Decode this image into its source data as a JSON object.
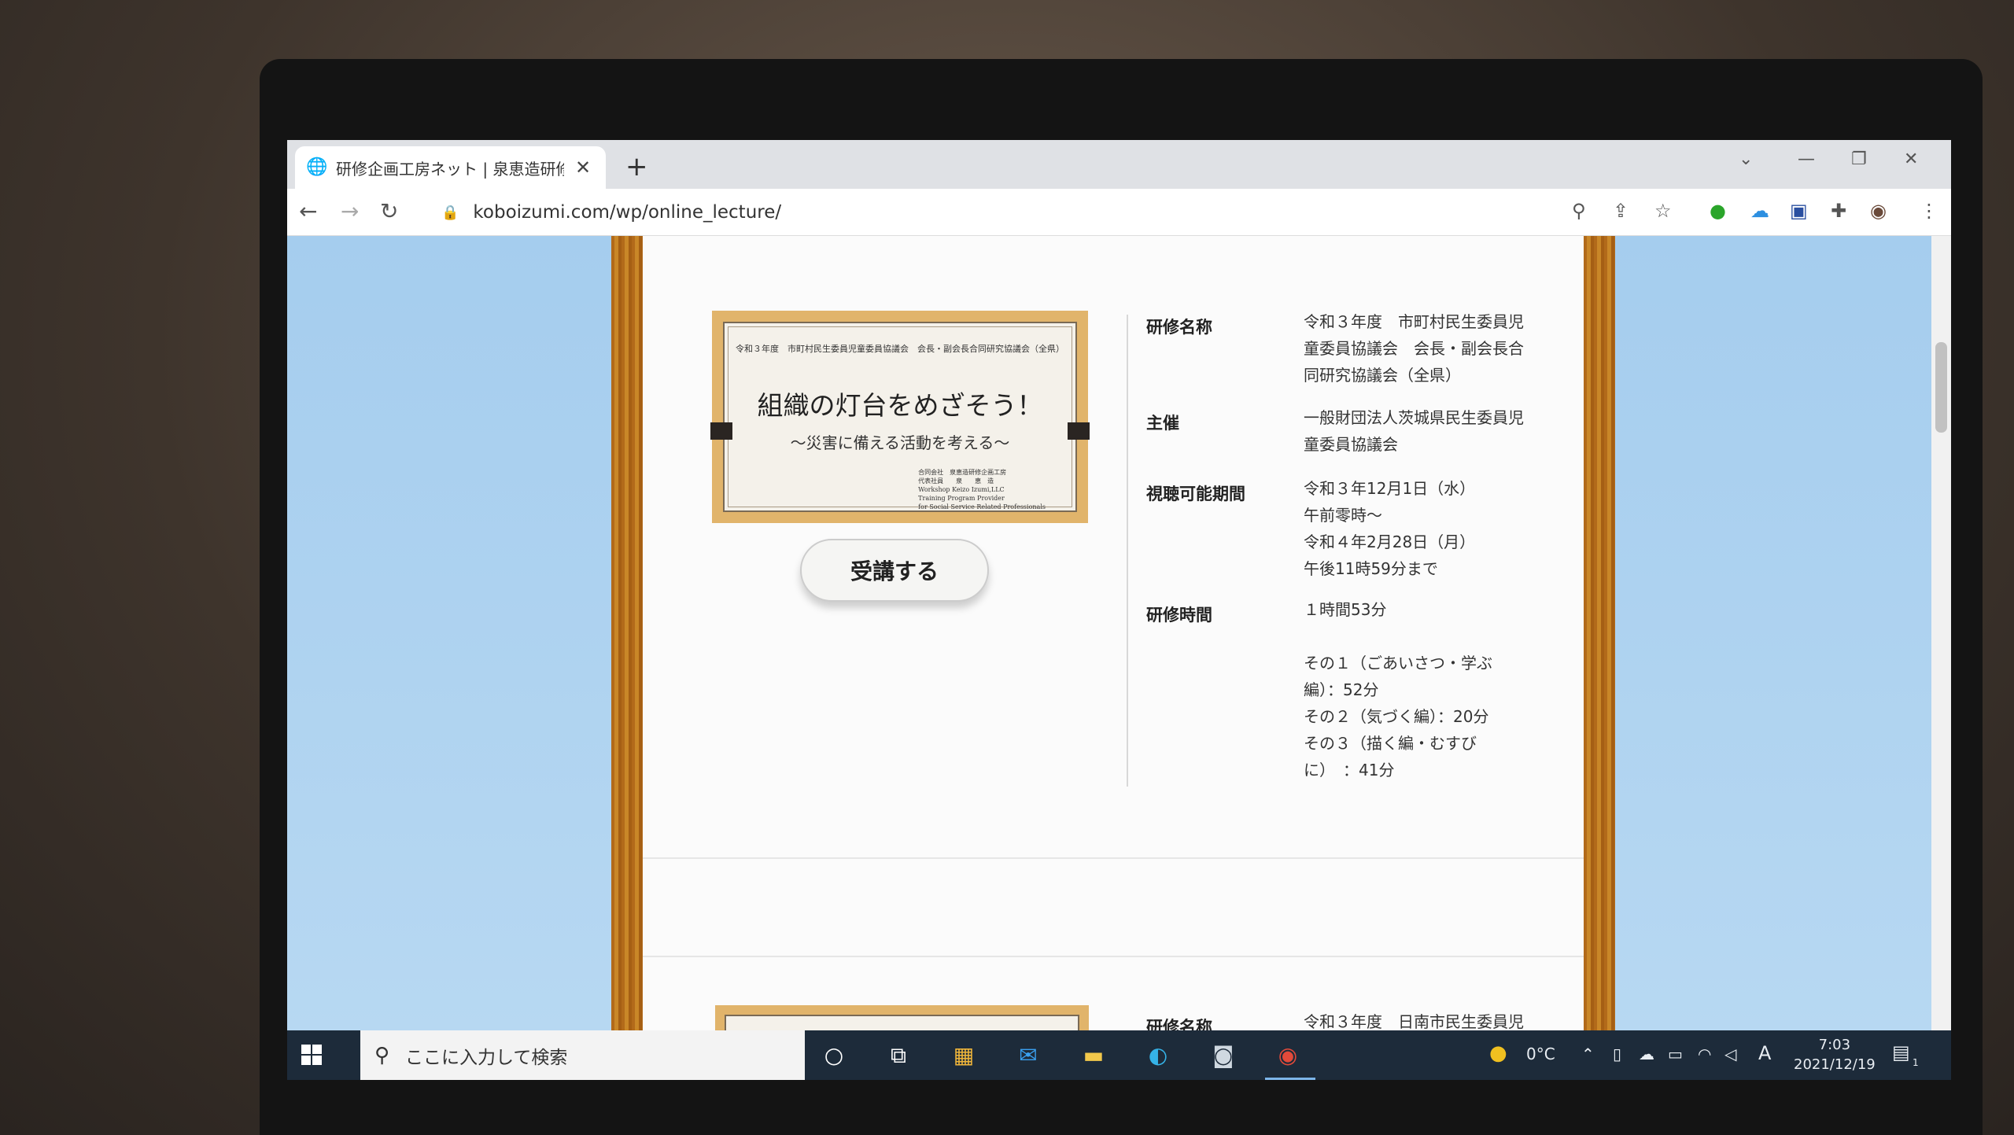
{
  "browser": {
    "tab_title": "研修企画工房ネット | 泉恵造研修",
    "tab_close": "✕",
    "new_tab": "+",
    "url": "koboizumi.com/wp/online_lecture/"
  },
  "course": {
    "thumbnail": {
      "top_line": "令和３年度　市町村民生委員児童委員協議会　会長・副会長合同研究協議会（全県）",
      "main_title": "組織の灯台をめざそう！",
      "subtitle": "～災害に備える活動を考える～",
      "author_lines": [
        "合同会社　泉恵造研修企画工房",
        "代表社員　　泉　　恵　造",
        "Workshop Keizo Izumi,LLC",
        "Training Program Provider",
        "for Social Service Related Professionals"
      ]
    },
    "button_label": "受講する",
    "details": [
      {
        "label": "研修名称",
        "lines": [
          "令和３年度　市町村民生委員児",
          "童委員協議会　会長・副会長合",
          "同研究協議会（全県）"
        ]
      },
      {
        "label": "主催",
        "lines": [
          "一般財団法人茨城県民生委員児",
          "童委員協議会"
        ]
      },
      {
        "label": "視聴可能期間",
        "lines": [
          "令和３年12月1日（水）",
          "午前零時～",
          "令和４年2月28日（月）",
          "午後11時59分まで"
        ]
      },
      {
        "label": "研修時間",
        "lines": [
          "１時間53分",
          "",
          "その１（ごあいさつ・学ぶ",
          "編）：52分",
          "その２（気づく編）：20分",
          "その３（描く編・むすび",
          "に）　：41分"
        ]
      }
    ]
  },
  "next_course": {
    "label": "研修名称",
    "value": "令和３年度　日南市民生委員児"
  },
  "taskbar": {
    "search_placeholder": "ここに入力して検索",
    "temperature": "0°C",
    "ime": "A",
    "time": "7:03",
    "date": "2021/12/19",
    "notification_count": "1"
  }
}
